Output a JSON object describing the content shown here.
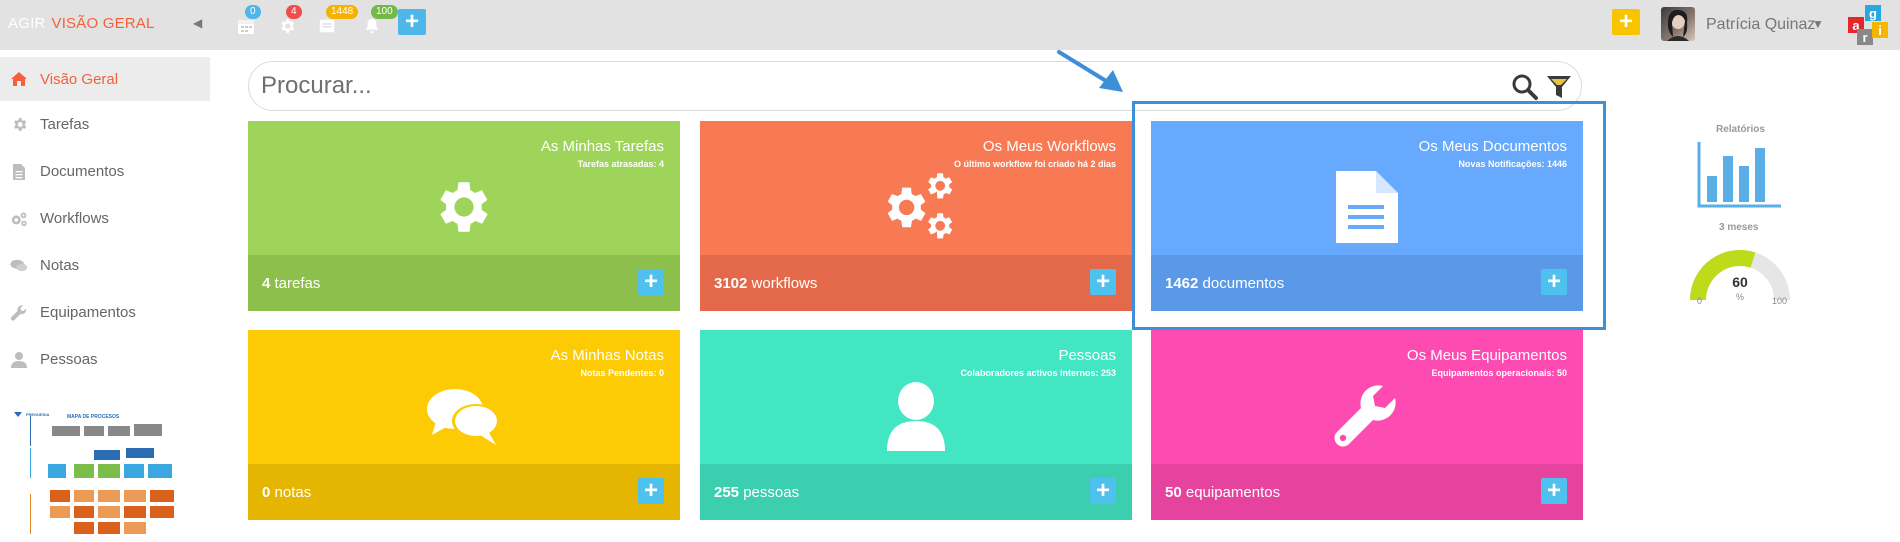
{
  "topbar": {
    "brand": "AGIR",
    "section_title": "VISÃO GERAL",
    "collapse_icon": "chevron-left-icon",
    "badges": {
      "calendar": "0",
      "settings": "4",
      "messages": "1448",
      "notifications": "100"
    },
    "user_name": "Patrícia Quinaz",
    "logo_letters": [
      "a",
      "g",
      "r",
      "i"
    ]
  },
  "sidebar": {
    "items": [
      {
        "label": "Visão Geral",
        "icon": "home-icon",
        "active": true
      },
      {
        "label": "Tarefas",
        "icon": "gear-icon"
      },
      {
        "label": "Documentos",
        "icon": "document-icon"
      },
      {
        "label": "Workflows",
        "icon": "gears-icon"
      },
      {
        "label": "Notas",
        "icon": "chat-icon"
      },
      {
        "label": "Equipamentos",
        "icon": "wrench-icon"
      },
      {
        "label": "Pessoas",
        "icon": "user-icon"
      }
    ],
    "process_map": {
      "logo_text": "FREGUESIA",
      "title": "MAPA DE PROCESOS"
    }
  },
  "search": {
    "placeholder": "Procurar..."
  },
  "cards": [
    {
      "title": "As Minhas Tarefas",
      "subtitle": "Tarefas atrasadas: 4",
      "count": "4",
      "unit": "tarefas",
      "icon": "gear-icon"
    },
    {
      "title": "Os Meus Workflows",
      "subtitle": "O último workflow foi criado há 2 dias",
      "count": "3102",
      "unit": "workflows",
      "icon": "gears-icon"
    },
    {
      "title": "Os Meus Documentos",
      "subtitle": "Novas Notificações: 1446",
      "count": "1462",
      "unit": "documentos",
      "icon": "document-icon"
    },
    {
      "title": "As Minhas Notas",
      "subtitle": "Notas Pendentes: 0",
      "count": "0",
      "unit": "notas",
      "icon": "chat-icon"
    },
    {
      "title": "Pessoas",
      "subtitle": "Colaboradores activos internos: 253",
      "count": "255",
      "unit": "pessoas",
      "icon": "user-icon"
    },
    {
      "title": "Os Meus Equipamentos",
      "subtitle": "Equipamentos operacionais: 50",
      "count": "50",
      "unit": "equipamentos",
      "icon": "wrench-icon"
    }
  ],
  "colors": {
    "accent": "#f5603c",
    "card_tarefas": "#9fd45a",
    "card_workflows": "#f87a55",
    "card_documentos": "#66a9fd",
    "card_notas": "#fdcb03",
    "card_pessoas": "#43e6c3",
    "card_equipamentos": "#fe4bb2",
    "highlight": "#3c8fd8"
  },
  "widgets": {
    "reports_label": "Relatórios",
    "period_label": "3 meses",
    "gauge": {
      "value": 60,
      "value_text": "60",
      "unit": "%",
      "min": "0",
      "max": "100"
    }
  }
}
